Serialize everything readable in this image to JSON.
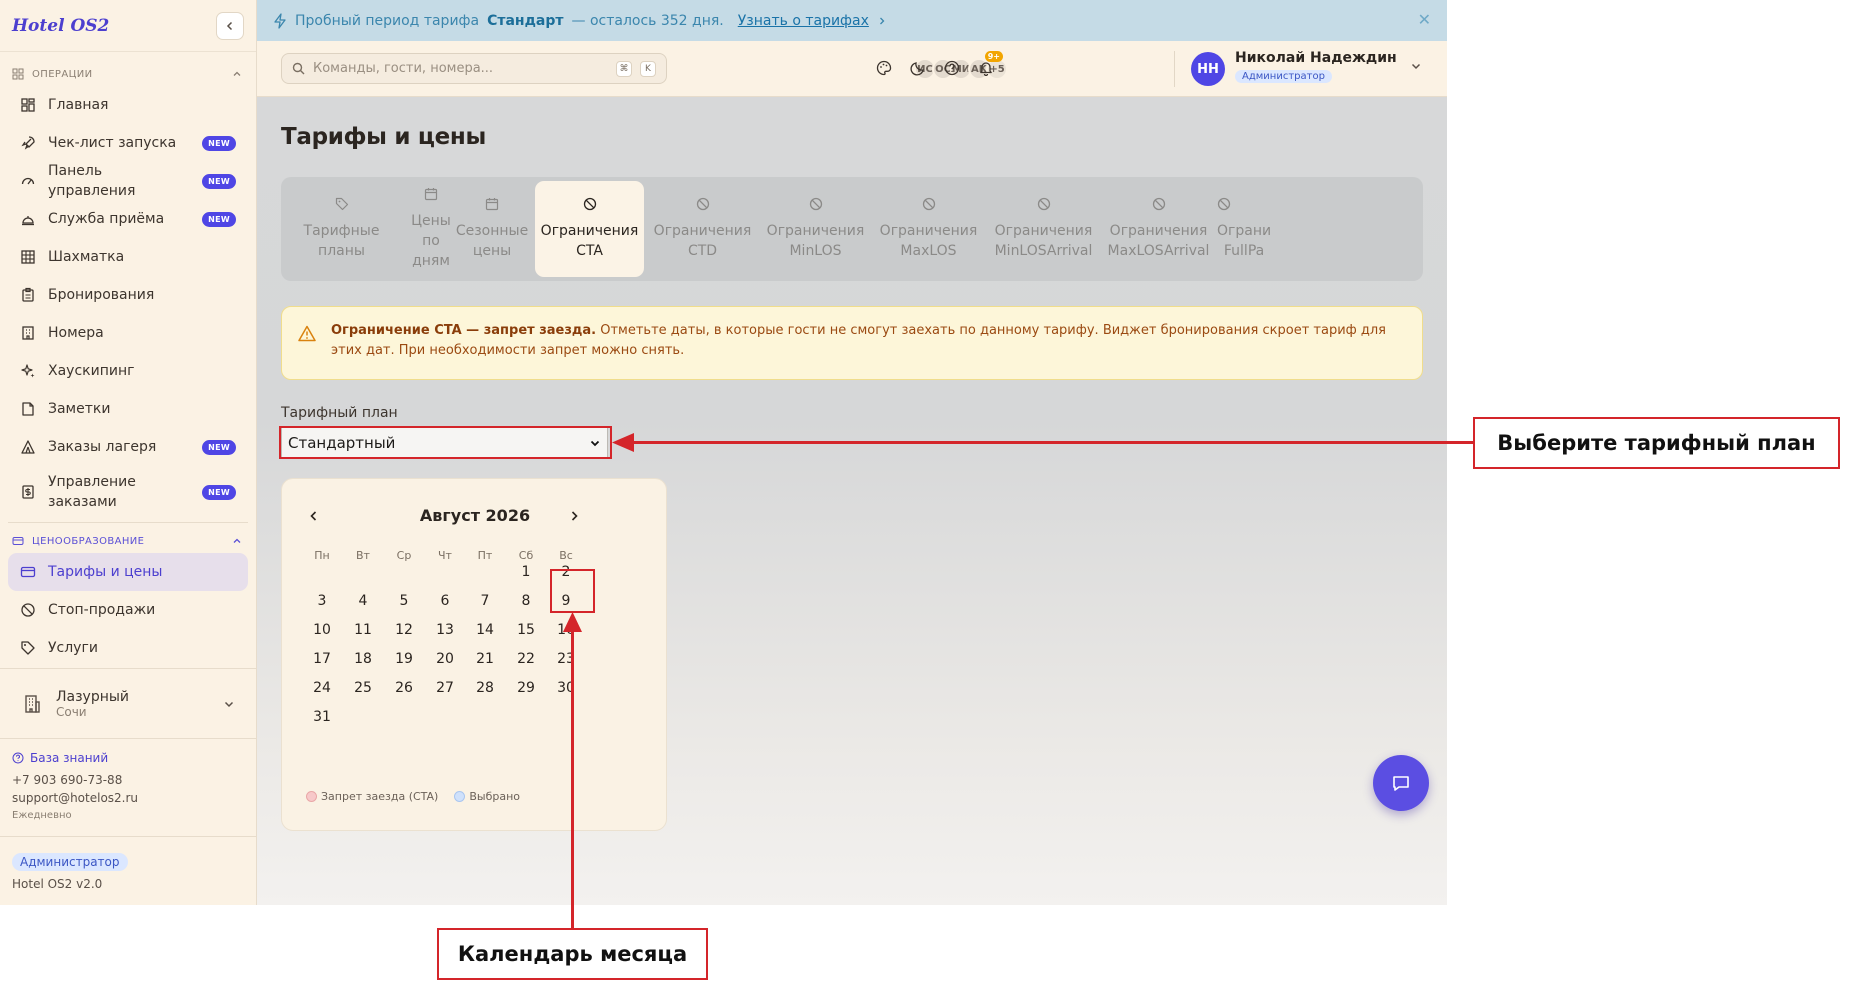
{
  "sidebar": {
    "brand": "Hotel OS2",
    "sections": {
      "operations": "ОПЕРАЦИИ",
      "pricing": "ЦЕНООБРАЗОВАНИЕ"
    },
    "items": [
      {
        "label": "Главная",
        "icon": "dashboard-icon"
      },
      {
        "label": "Чек-лист запуска",
        "icon": "rocket-icon",
        "badge": "NEW"
      },
      {
        "label": "Панель управления",
        "icon": "gauge-icon",
        "badge": "NEW"
      },
      {
        "label": "Служба приёма",
        "icon": "bell-desk-icon",
        "badge": "NEW"
      },
      {
        "label": "Шахматка",
        "icon": "grid-icon"
      },
      {
        "label": "Бронирования",
        "icon": "clipboard-icon"
      },
      {
        "label": "Номера",
        "icon": "building-icon"
      },
      {
        "label": "Хаускипинг",
        "icon": "sparkle-icon"
      },
      {
        "label": "Заметки",
        "icon": "note-icon"
      },
      {
        "label": "Заказы лагеря",
        "icon": "tent-icon",
        "badge": "NEW"
      },
      {
        "label": "Управление заказами",
        "icon": "dollar-doc-icon",
        "badge": "NEW"
      }
    ],
    "pricing_items": [
      {
        "label": "Тарифы и цены",
        "icon": "card-icon"
      },
      {
        "label": "Стоп-продажи",
        "icon": "ban-icon"
      },
      {
        "label": "Услуги",
        "icon": "tag-icon"
      }
    ],
    "property": {
      "name": "Лазурный",
      "city": "Сочи"
    },
    "support": {
      "knowledge_base": "База знаний",
      "phone": "+7 903 690-73-88",
      "email": "support@hotelos2.ru",
      "hours": "Ежедневно"
    },
    "role": "Администратор",
    "version": "Hotel OS2 v2.0"
  },
  "banner": {
    "prefix": "Пробный период тарифа",
    "plan": "Стандарт",
    "suffix": "— осталось 352 дня.",
    "link": "Узнать о тарифах"
  },
  "topbar": {
    "search_placeholder": "Команды, гости, номера...",
    "kbd": [
      "⌘",
      "K"
    ],
    "avatars": [
      "ИС",
      "ОС",
      "МИ",
      "АК"
    ],
    "avatars_more": "+5",
    "notifications": "9+",
    "user": {
      "initials": "НН",
      "name": "Николай Надеждин",
      "role": "Администратор"
    }
  },
  "main": {
    "title": "Тарифы и цены",
    "tabs": [
      {
        "label": "Тарифные\nпланы",
        "icon": "tag-icon"
      },
      {
        "label": "Цены\nпо\nдням",
        "icon": "calendar-icon"
      },
      {
        "label": "Сезонные\nцены",
        "icon": "calendar-icon"
      },
      {
        "label": "Ограничения\nCTA",
        "icon": "ban-icon",
        "active": true
      },
      {
        "label": "Ограничения\nCTD",
        "icon": "ban-icon"
      },
      {
        "label": "Ограничения\nMinLOS",
        "icon": "ban-icon"
      },
      {
        "label": "Ограничения\nMaxLOS",
        "icon": "ban-icon"
      },
      {
        "label": "Ограничения\nMinLOSArrival",
        "icon": "ban-icon"
      },
      {
        "label": "Ограничения\nMaxLOSArrival",
        "icon": "ban-icon"
      },
      {
        "label": "Ограни\nFullPa",
        "icon": "ban-icon"
      }
    ],
    "alert": {
      "bold": "Ограничение CTA — запрет заезда.",
      "text": "Отметьте даты, в которые гости не смогут заехать по данному тарифу. Виджет бронирования скроет тариф для этих дат. При необходимости запрет можно снять."
    },
    "rate_plan": {
      "label": "Тарифный план",
      "value": "Стандартный",
      "options": [
        "Стандартный"
      ]
    },
    "calendar": {
      "month": "Август 2026",
      "weekdays": [
        "Пн",
        "Вт",
        "Ср",
        "Чт",
        "Пт",
        "Сб",
        "Вс"
      ],
      "first_weekday_index": 5,
      "days_in_month": 31,
      "legend": [
        {
          "label": "Запрет заезда (CTA)",
          "color": "#f7c9c9"
        },
        {
          "label": "Выбрано",
          "color": "#cfe1fb"
        }
      ]
    }
  },
  "annotations": {
    "rate_plan_callout": "Выберите тарифный план",
    "calendar_callout": "Календарь месяца",
    "color": "#d4252a"
  }
}
